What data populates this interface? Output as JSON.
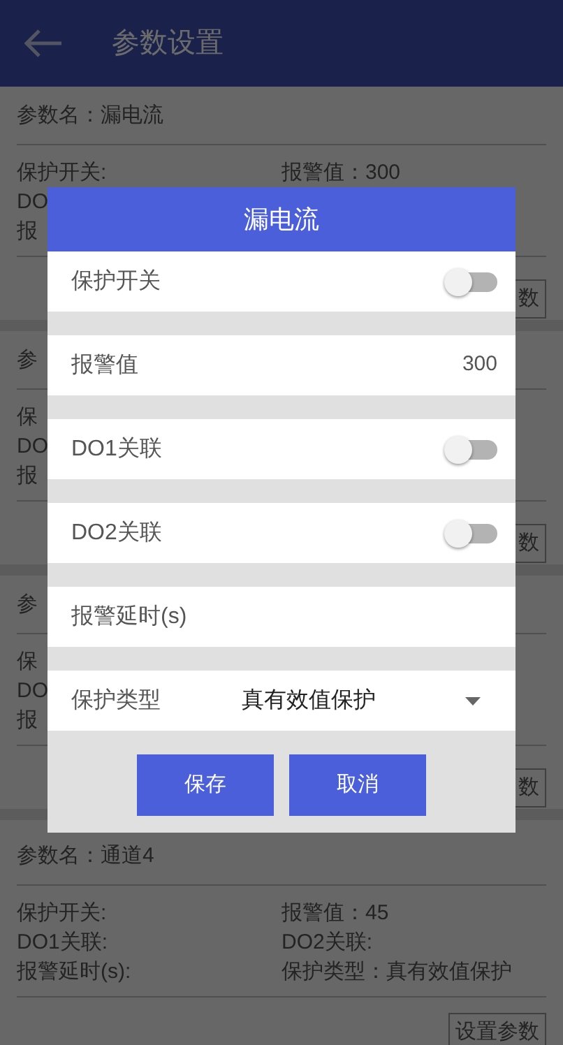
{
  "header": {
    "title": "参数设置"
  },
  "cards": [
    {
      "name": "参数名：漏电流",
      "rows": [
        {
          "left": "保护开关:",
          "right": "报警值：300"
        },
        {
          "left": "DO"
        },
        {
          "left": "报"
        }
      ],
      "button": "数"
    },
    {
      "name": "参",
      "rows": [
        {
          "left": "保"
        },
        {
          "left": "DO"
        },
        {
          "left": "报"
        }
      ],
      "button": "数"
    },
    {
      "name": "参",
      "rows": [
        {
          "left": "保"
        },
        {
          "left": "DO"
        },
        {
          "left": "报"
        }
      ],
      "button": "数"
    },
    {
      "name": "参数名：通道4",
      "rows": [
        {
          "left": "保护开关:",
          "right": "报警值：45"
        },
        {
          "left": "DO1关联:",
          "right": "DO2关联:"
        },
        {
          "left": "报警延时(s):",
          "right": "保护类型：真有效值保护"
        }
      ],
      "button": "设置参数"
    }
  ],
  "dialog": {
    "title": "漏电流",
    "rows": [
      {
        "kind": "toggle",
        "label": "保护开关",
        "on": false
      },
      {
        "kind": "value",
        "label": "报警值",
        "value": "300"
      },
      {
        "kind": "toggle",
        "label": "DO1关联",
        "on": false
      },
      {
        "kind": "toggle",
        "label": "DO2关联",
        "on": false
      },
      {
        "kind": "input",
        "label": "报警延时(s)"
      },
      {
        "kind": "select",
        "label": "保护类型",
        "value": "真有效值保护"
      }
    ],
    "buttons": [
      "保存",
      "取消"
    ]
  }
}
